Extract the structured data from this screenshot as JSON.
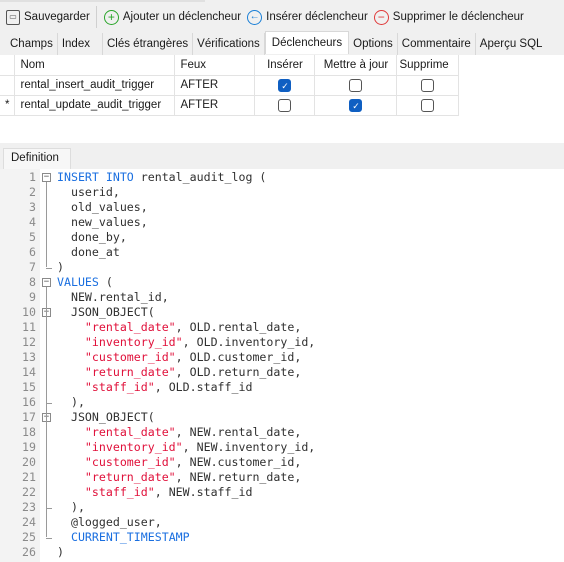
{
  "toolbar": {
    "save": "Sauvegarder",
    "add": "Ajouter un déclencheur",
    "insert": "Insérer déclencheur",
    "delete": "Supprimer le déclencheur"
  },
  "tabs": [
    "Champs",
    "Index",
    "Clés étrangères",
    "Vérifications",
    "Déclencheurs",
    "Options",
    "Commentaire",
    "Aperçu SQL"
  ],
  "active_tab": "Déclencheurs",
  "grid": {
    "columns": [
      "Nom",
      "Feux",
      "Insérer",
      "Mettre à jour",
      "Supprime"
    ],
    "rows": [
      {
        "marker": "",
        "name": "rental_insert_audit_trigger",
        "fires": "AFTER",
        "insert": true,
        "update": false,
        "delete": false
      },
      {
        "marker": "*",
        "name": "rental_update_audit_trigger",
        "fires": "AFTER",
        "insert": false,
        "update": true,
        "delete": false
      }
    ]
  },
  "definition_tab": "Definition",
  "colors": {
    "keyword": "#1a6fe0",
    "string": "#e0103a",
    "accent": "#0f5fc2"
  },
  "code": {
    "lines": [
      [
        [
          "kw",
          "INSERT INTO "
        ],
        [
          "pl",
          "rental_audit_log ("
        ]
      ],
      [
        [
          "pl",
          "  userid,"
        ]
      ],
      [
        [
          "pl",
          "  old_values,"
        ]
      ],
      [
        [
          "pl",
          "  new_values,"
        ]
      ],
      [
        [
          "pl",
          "  done_by,"
        ]
      ],
      [
        [
          "pl",
          "  done_at"
        ]
      ],
      [
        [
          "pl",
          ")"
        ]
      ],
      [
        [
          "kw",
          "VALUES "
        ],
        [
          "pl",
          "("
        ]
      ],
      [
        [
          "pl",
          "  NEW.rental_id,"
        ]
      ],
      [
        [
          "pl",
          "  JSON_OBJECT("
        ]
      ],
      [
        [
          "pl",
          "    "
        ],
        [
          "str",
          "\"rental_date\""
        ],
        [
          "pl",
          ", OLD.rental_date,"
        ]
      ],
      [
        [
          "pl",
          "    "
        ],
        [
          "str",
          "\"inventory_id\""
        ],
        [
          "pl",
          ", OLD.inventory_id,"
        ]
      ],
      [
        [
          "pl",
          "    "
        ],
        [
          "str",
          "\"customer_id\""
        ],
        [
          "pl",
          ", OLD.customer_id,"
        ]
      ],
      [
        [
          "pl",
          "    "
        ],
        [
          "str",
          "\"return_date\""
        ],
        [
          "pl",
          ", OLD.return_date,"
        ]
      ],
      [
        [
          "pl",
          "    "
        ],
        [
          "str",
          "\"staff_id\""
        ],
        [
          "pl",
          ", OLD.staff_id"
        ]
      ],
      [
        [
          "pl",
          "  ),"
        ]
      ],
      [
        [
          "pl",
          "  JSON_OBJECT("
        ]
      ],
      [
        [
          "pl",
          "    "
        ],
        [
          "str",
          "\"rental_date\""
        ],
        [
          "pl",
          ", NEW.rental_date,"
        ]
      ],
      [
        [
          "pl",
          "    "
        ],
        [
          "str",
          "\"inventory_id\""
        ],
        [
          "pl",
          ", NEW.inventory_id,"
        ]
      ],
      [
        [
          "pl",
          "    "
        ],
        [
          "str",
          "\"customer_id\""
        ],
        [
          "pl",
          ", NEW.customer_id,"
        ]
      ],
      [
        [
          "pl",
          "    "
        ],
        [
          "str",
          "\"return_date\""
        ],
        [
          "pl",
          ", NEW.return_date,"
        ]
      ],
      [
        [
          "pl",
          "    "
        ],
        [
          "str",
          "\"staff_id\""
        ],
        [
          "pl",
          ", NEW.staff_id"
        ]
      ],
      [
        [
          "pl",
          "  ),"
        ]
      ],
      [
        [
          "pl",
          "  @logged_user,"
        ]
      ],
      [
        [
          "pl",
          "  "
        ],
        [
          "kw",
          "CURRENT_TIMESTAMP"
        ]
      ],
      [
        [
          "pl",
          ")"
        ]
      ]
    ]
  }
}
